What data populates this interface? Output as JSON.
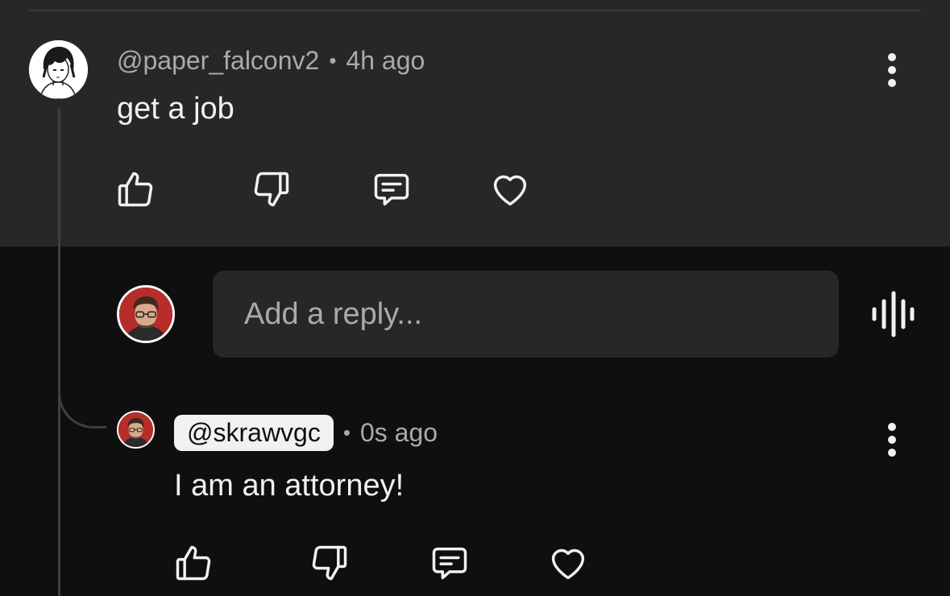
{
  "top_comment": {
    "author": "@paper_falconv2",
    "separator": "•",
    "time": "4h ago",
    "text": "get a job",
    "avatar_icon": "anime-character-avatar",
    "actions": [
      "like-icon",
      "dislike-icon",
      "reply-icon",
      "heart-icon"
    ]
  },
  "reply_input": {
    "placeholder": "Add a reply...",
    "avatar_icon": "user-avatar",
    "voice_icon": "voice-search-icon"
  },
  "reply": {
    "author": "@skrawvgc",
    "separator": "•",
    "time": "0s ago",
    "text": "I am an attorney!",
    "avatar_icon": "user-avatar",
    "actions": [
      "like-icon",
      "dislike-icon",
      "reply-icon",
      "heart-icon"
    ]
  },
  "colors": {
    "top_background": "#272727",
    "page_background": "#0f0f0f",
    "text_primary": "#f1f1f1",
    "text_secondary": "#aaaaaa",
    "handle_chip": "#f1f1f1"
  }
}
